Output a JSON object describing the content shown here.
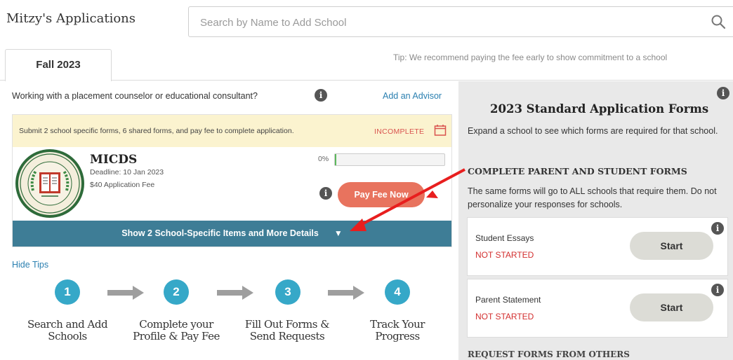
{
  "header": {
    "app_title": "Mitzy's Applications",
    "search_placeholder": "Search by Name to Add School",
    "tip": "Tip: We recommend paying the fee early to show commitment to a school"
  },
  "tabs": [
    {
      "label": "Fall 2023",
      "active": true
    }
  ],
  "counselor": {
    "prompt": "Working with a placement counselor or educational consultant?",
    "add_advisor_label": "Add an Advisor"
  },
  "application": {
    "requirements_text": "Submit 2 school specific forms, 6 shared forms, and pay fee to complete application.",
    "status": "INCOMPLETE",
    "school_name": "MICDS",
    "deadline": "Deadline: 10 Jan 2023",
    "fee": "$40 Application Fee",
    "progress_label": "0%",
    "progress_fraction": 0.0,
    "pay_fee_label": "Pay Fee Now",
    "details_label": "Show 2 School-Specific Items and More Details"
  },
  "tips": {
    "hide_label": "Hide Tips",
    "steps": [
      {
        "number": "1",
        "line1": "Search and Add",
        "line2": "Schools"
      },
      {
        "number": "2",
        "line1": "Complete your",
        "line2": "Profile & Pay Fee"
      },
      {
        "number": "3",
        "line1": "Fill Out Forms &",
        "line2": "Send Requests"
      },
      {
        "number": "4",
        "line1": "Track Your",
        "line2": "Progress"
      }
    ]
  },
  "forms_panel": {
    "title": "2023 Standard Application Forms",
    "description": "Expand a school to see which forms are required for that school.",
    "section_heading": "COMPLETE PARENT AND STUDENT FORMS",
    "note": "The same forms will go to ALL schools that require them. Do not personalize your responses for schools.",
    "forms": [
      {
        "name": "Student Essays",
        "status": "NOT STARTED",
        "action": "Start"
      },
      {
        "name": "Parent Statement",
        "status": "NOT STARTED",
        "action": "Start"
      }
    ],
    "request_heading": "REQUEST FORMS FROM OTHERS"
  },
  "colors": {
    "accent_blue": "#36a8c8",
    "details_bar": "#3e7d96",
    "pay_button": "#e8735e",
    "status_red": "#d32f2f",
    "notice_yellow": "#fbf3cf",
    "seal_green": "#2e6b3a",
    "annotation_arrow": "#e81e1e"
  },
  "icons": {
    "search": "search-icon",
    "info": "info-icon",
    "calendar": "calendar-icon",
    "chevron": "chevron-down-icon"
  },
  "seal": {
    "label": "Seal of MICDS"
  }
}
